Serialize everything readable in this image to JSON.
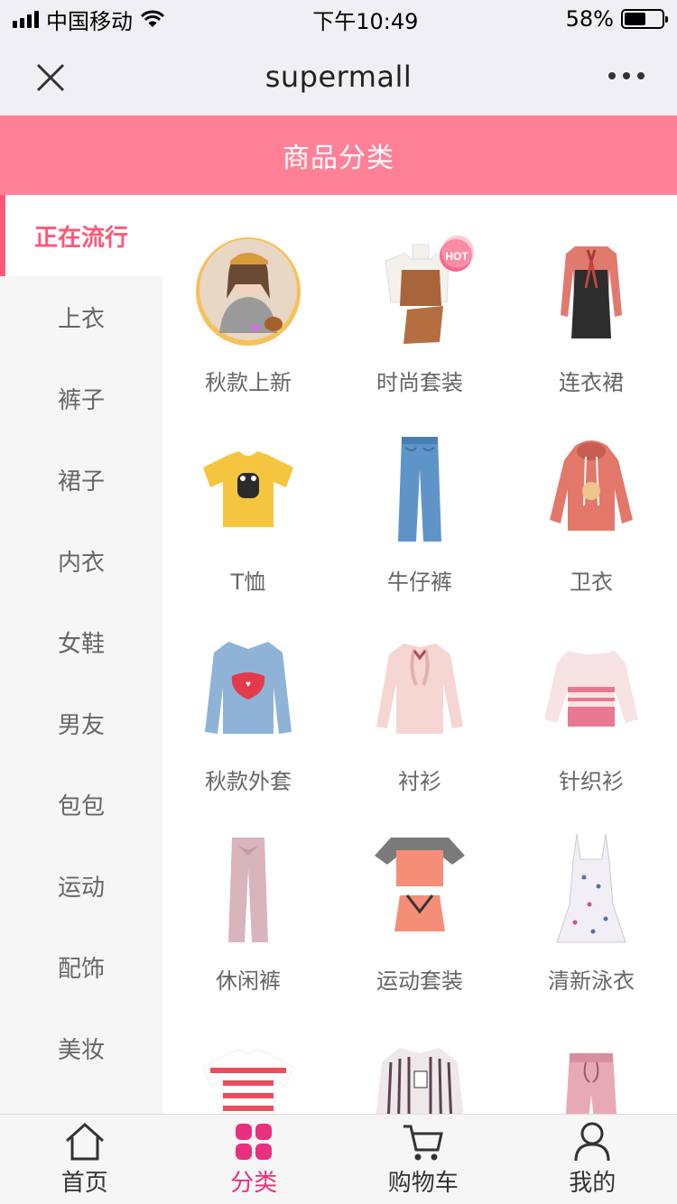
{
  "status_bar": {
    "carrier": "中国移动",
    "time": "下午10:49",
    "battery": "58%",
    "battery_level": 0.58
  },
  "nav": {
    "title": "supermall",
    "close_icon": "close-icon",
    "more_icon": "more-icon"
  },
  "header": {
    "title": "商品分类"
  },
  "sidebar": {
    "items": [
      {
        "label": "正在流行",
        "active": true
      },
      {
        "label": "上衣"
      },
      {
        "label": "裤子"
      },
      {
        "label": "裙子"
      },
      {
        "label": "内衣"
      },
      {
        "label": "女鞋"
      },
      {
        "label": "男友"
      },
      {
        "label": "包包"
      },
      {
        "label": "运动"
      },
      {
        "label": "配饰"
      },
      {
        "label": "美妆"
      }
    ]
  },
  "grid": {
    "items": [
      {
        "label": "秋款上新",
        "icon": "autumn-new-icon"
      },
      {
        "label": "时尚套装",
        "icon": "fashion-set-icon",
        "badge": "HOT"
      },
      {
        "label": "连衣裙",
        "icon": "dress-icon"
      },
      {
        "label": "T恤",
        "icon": "tshirt-icon"
      },
      {
        "label": "牛仔裤",
        "icon": "jeans-icon"
      },
      {
        "label": "卫衣",
        "icon": "hoodie-icon"
      },
      {
        "label": "秋款外套",
        "icon": "jacket-icon"
      },
      {
        "label": "衬衫",
        "icon": "blouse-icon"
      },
      {
        "label": "针织衫",
        "icon": "knit-icon"
      },
      {
        "label": "休闲裤",
        "icon": "casual-pants-icon"
      },
      {
        "label": "运动套装",
        "icon": "sport-set-icon"
      },
      {
        "label": "清新泳衣",
        "icon": "swimsuit-icon"
      },
      {
        "label": "",
        "icon": "striped-tee-icon"
      },
      {
        "label": "",
        "icon": "striped-shirt-icon"
      },
      {
        "label": "",
        "icon": "pink-pants-icon"
      }
    ]
  },
  "tabbar": {
    "items": [
      {
        "label": "首页",
        "icon": "home-icon"
      },
      {
        "label": "分类",
        "icon": "category-icon",
        "active": true
      },
      {
        "label": "购物车",
        "icon": "cart-icon"
      },
      {
        "label": "我的",
        "icon": "profile-icon"
      }
    ]
  },
  "colors": {
    "accent": "#ff8198",
    "active_text": "#ff5777",
    "tab_active": "#e8307e"
  }
}
